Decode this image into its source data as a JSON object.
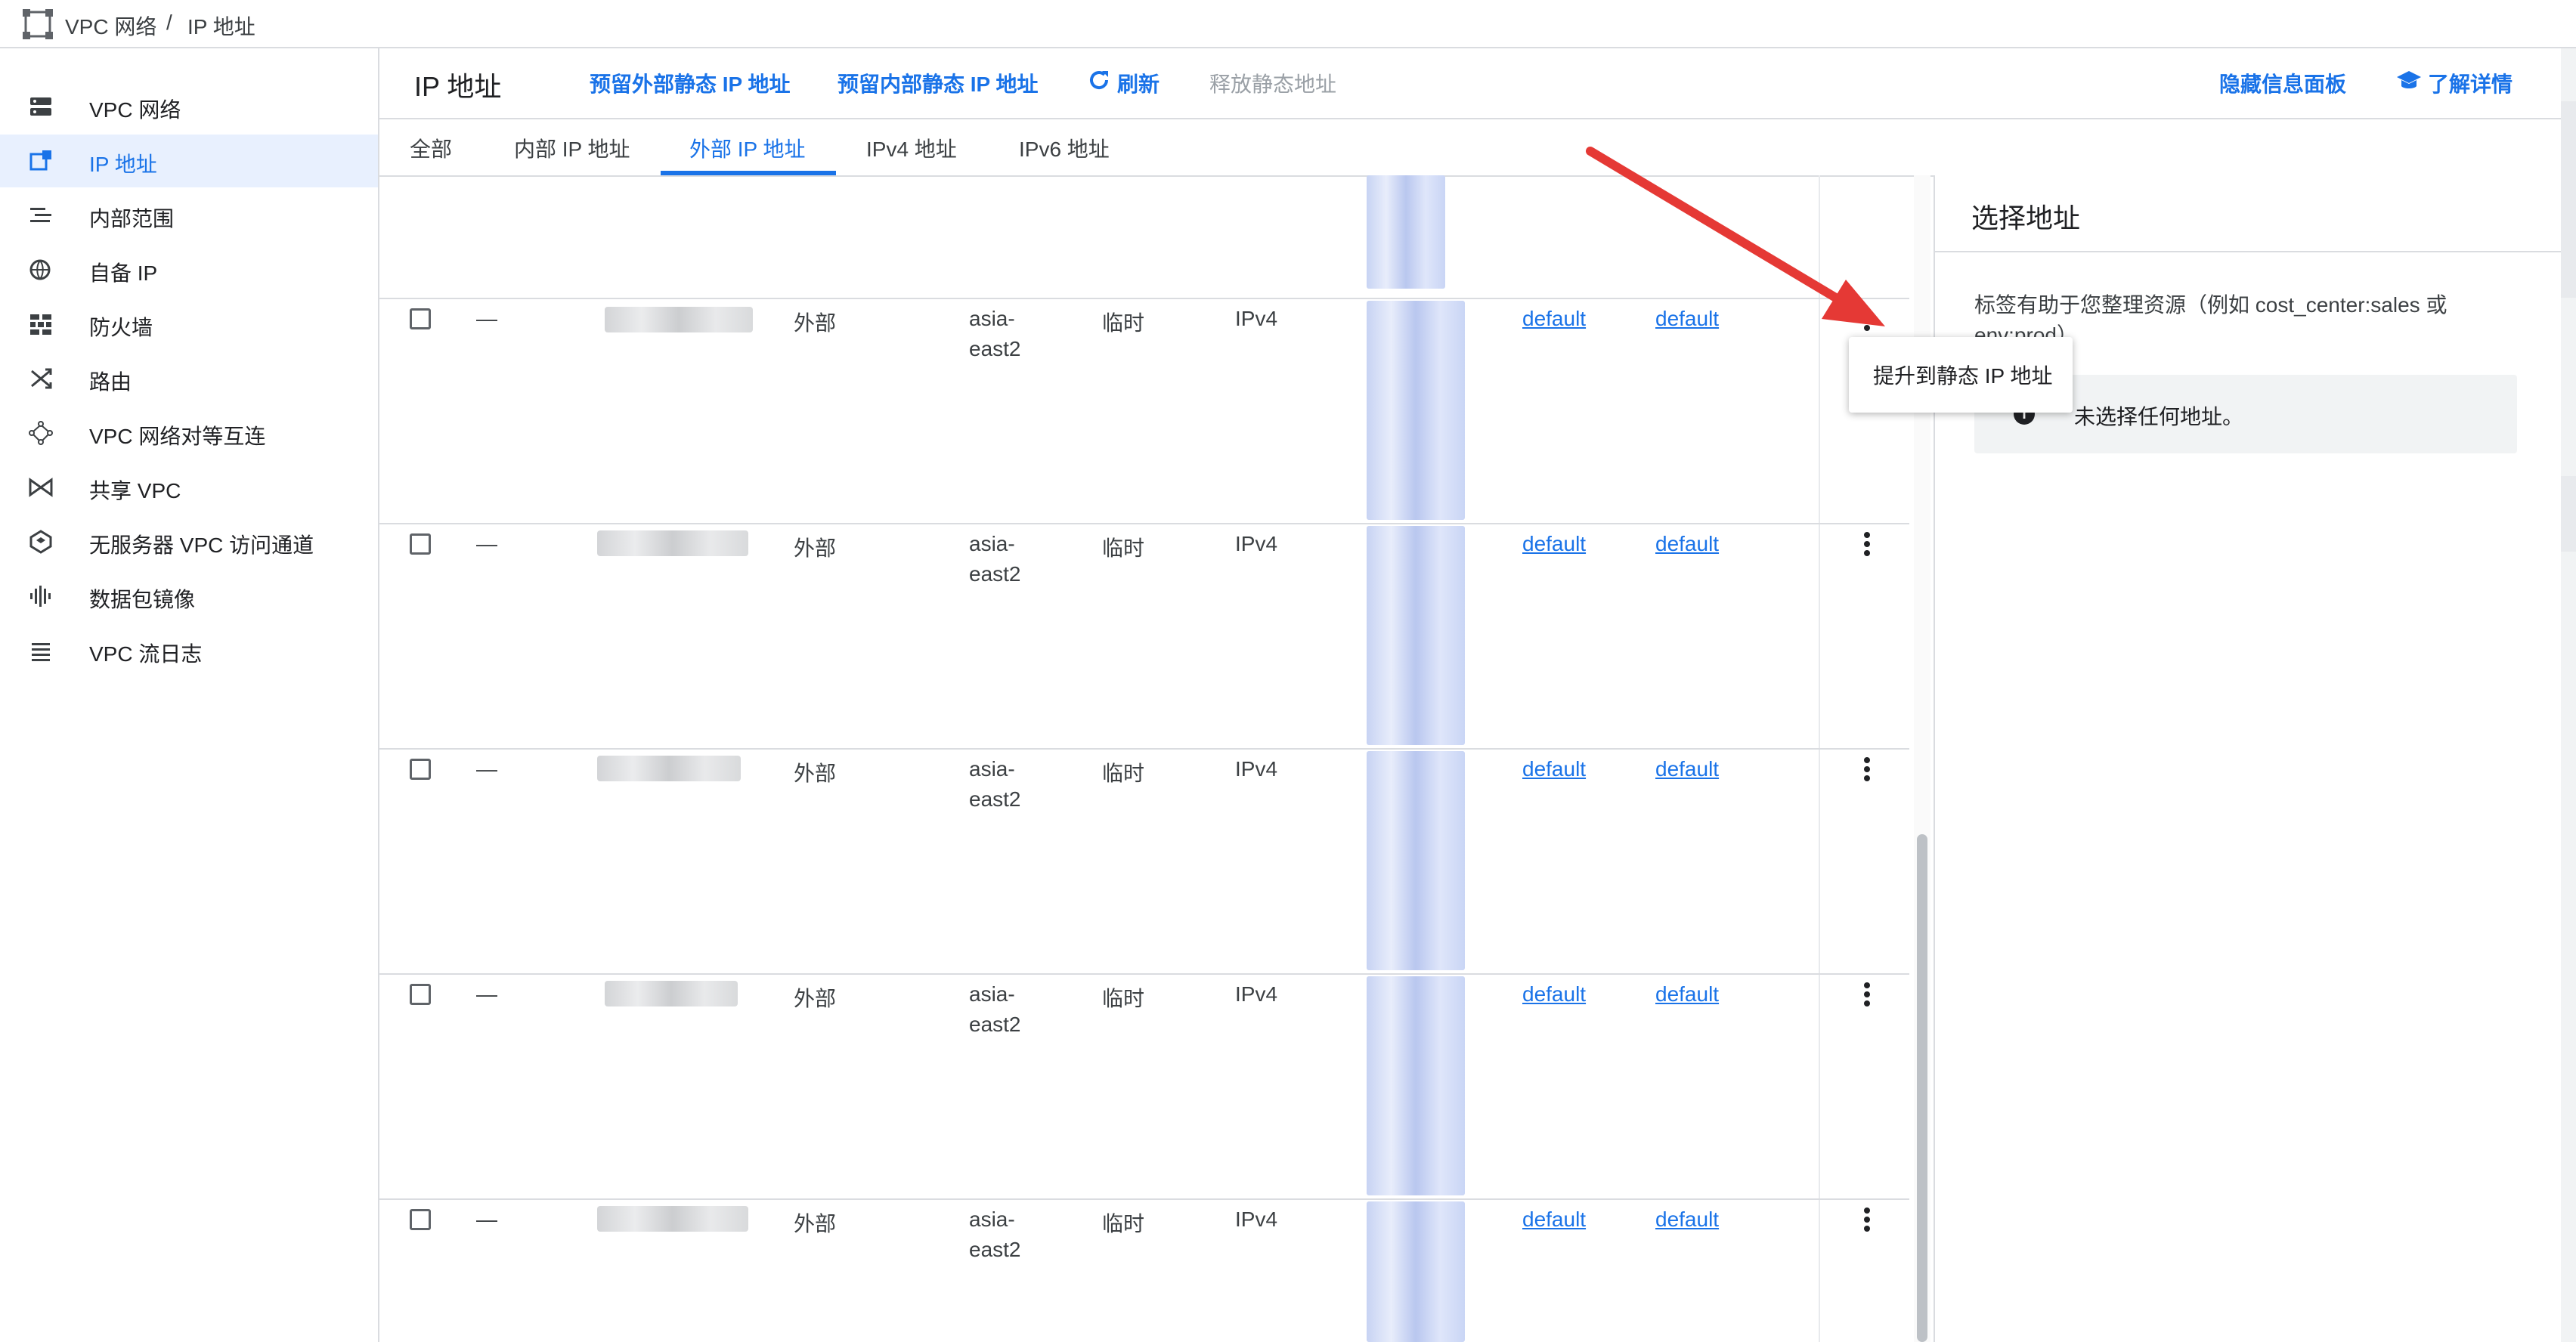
{
  "breadcrumb": {
    "root": "VPC 网络",
    "sep": "/",
    "current": "IP 地址"
  },
  "sidebar": {
    "items": [
      {
        "label": "VPC 网络",
        "icon": "vpc-network-icon",
        "active": false
      },
      {
        "label": "IP 地址",
        "icon": "ip-address-icon",
        "active": true
      },
      {
        "label": "内部范围",
        "icon": "internal-range-icon",
        "active": false
      },
      {
        "label": "自备 IP",
        "icon": "byoip-globe-icon",
        "active": false
      },
      {
        "label": "防火墙",
        "icon": "firewall-icon",
        "active": false
      },
      {
        "label": "路由",
        "icon": "routes-icon",
        "active": false
      },
      {
        "label": "VPC 网络对等互连",
        "icon": "peering-icon",
        "active": false
      },
      {
        "label": "共享 VPC",
        "icon": "shared-vpc-icon",
        "active": false
      },
      {
        "label": "无服务器 VPC 访问通道",
        "icon": "serverless-connector-icon",
        "active": false
      },
      {
        "label": "数据包镜像",
        "icon": "packet-mirroring-icon",
        "active": false
      },
      {
        "label": "VPC 流日志",
        "icon": "flow-logs-icon",
        "active": false
      }
    ]
  },
  "header": {
    "title": "IP 地址",
    "actions": {
      "reserve_external": "预留外部静态 IP 地址",
      "reserve_internal": "预留内部静态 IP 地址",
      "refresh": "刷新",
      "release": "释放静态地址",
      "hide_panel": "隐藏信息面板",
      "learn_more": "了解详情"
    }
  },
  "tabs": [
    {
      "label": "全部",
      "active": false
    },
    {
      "label": "内部 IP 地址",
      "active": false
    },
    {
      "label": "外部 IP 地址",
      "active": true
    },
    {
      "label": "IPv4 地址",
      "active": false
    },
    {
      "label": "IPv6 地址",
      "active": false
    }
  ],
  "rows": [
    {
      "dash": "—",
      "access": "外部",
      "region1": "asia-",
      "region2": "east2",
      "type": "临时",
      "version": "IPv4",
      "network": "default",
      "subnet": "default"
    },
    {
      "dash": "—",
      "access": "外部",
      "region1": "asia-",
      "region2": "east2",
      "type": "临时",
      "version": "IPv4",
      "network": "default",
      "subnet": "default"
    },
    {
      "dash": "—",
      "access": "外部",
      "region1": "asia-",
      "region2": "east2",
      "type": "临时",
      "version": "IPv4",
      "network": "default",
      "subnet": "default"
    },
    {
      "dash": "—",
      "access": "外部",
      "region1": "asia-",
      "region2": "east2",
      "type": "临时",
      "version": "IPv4",
      "network": "default",
      "subnet": "default"
    },
    {
      "dash": "—",
      "access": "外部",
      "region1": "asia-",
      "region2": "east2",
      "type": "临时",
      "version": "IPv4",
      "network": "default",
      "subnet": "default"
    }
  ],
  "tooltip": {
    "label": "提升到静态 IP 地址"
  },
  "panel": {
    "title": "选择地址",
    "description": "标签有助于您整理资源（例如 cost_center:sales 或 env:prod）",
    "empty_message": "未选择任何地址。"
  },
  "colors": {
    "accent": "#1a73e8",
    "active_bg": "#e8f0fe",
    "arrow": "#e53935"
  }
}
